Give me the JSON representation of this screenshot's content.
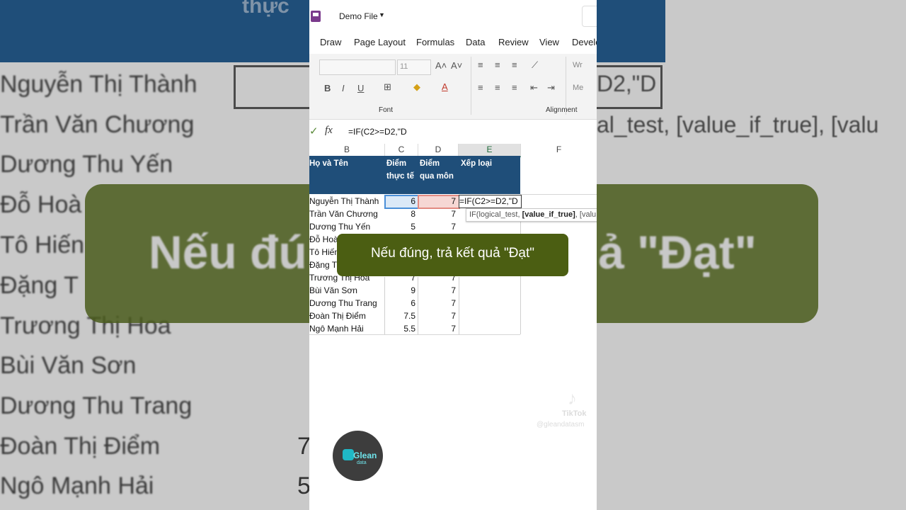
{
  "app": {
    "title": "Demo File",
    "tabs": [
      "Draw",
      "Page Layout",
      "Formulas",
      "Data",
      "Review",
      "View",
      "Develo"
    ]
  },
  "ribbon": {
    "font_size": "11",
    "font_group_label": "Font",
    "alignment_group_label": "Alignment",
    "wrap_label": "Wr",
    "merge_label": "Me"
  },
  "formula_bar": {
    "fx": "fx",
    "content": "=IF(C2>=D2,\"D"
  },
  "columns": [
    "B",
    "C",
    "D",
    "E",
    "F"
  ],
  "header_row": {
    "b": "Họ và Tên",
    "c_line1": "Điểm",
    "c_line2": "thực tế",
    "d_line1": "Điểm",
    "d_line2": "qua môn",
    "e": "Xếp loại"
  },
  "rows": [
    {
      "name": "Nguyễn Thị Thành",
      "actual": "6",
      "pass": "7"
    },
    {
      "name": "Trần Văn Chương",
      "actual": "8",
      "pass": "7"
    },
    {
      "name": "Dương Thu Yến",
      "actual": "5",
      "pass": "7"
    },
    {
      "name": "Đỗ Hoà",
      "actual": "",
      "pass": ""
    },
    {
      "name": "Tô Hiến",
      "actual": "",
      "pass": ""
    },
    {
      "name": "Đặng T",
      "actual": "",
      "pass": ""
    },
    {
      "name": "Trương Thị Hoa",
      "actual": "7",
      "pass": "7"
    },
    {
      "name": "Bùi Văn Sơn",
      "actual": "9",
      "pass": "7"
    },
    {
      "name": "Dương Thu Trang",
      "actual": "6",
      "pass": "7"
    },
    {
      "name": "Đoàn Thị Điểm",
      "actual": "7.5",
      "pass": "7"
    },
    {
      "name": "Ngô Mạnh Hải",
      "actual": "5.5",
      "pass": "7"
    }
  ],
  "edit_cell": "=IF(C2>=D2,\"D",
  "tooltip": {
    "prefix": "IF(logical_test, ",
    "bold": "[value_if_true]",
    "suffix": ", [valu"
  },
  "banner": "Nếu đúng, trả kết quả \"Đạt\"",
  "background": {
    "header_text": "thực",
    "names": [
      "Nguyễn Thị Thành",
      "Trần Văn Chương",
      "Dương Thu Yến",
      "Đỗ Hoà",
      "Tô Hiến",
      "Đặng T",
      "Trương Thị Hoa",
      "Bùi Văn Sơn",
      "Dương Thu Trang",
      "Đoàn Thị Điểm",
      "Ngô Mạnh Hải"
    ],
    "formula": "D2,\"D",
    "tooltip": "al_test, [value_if_true], [valu",
    "banner_left": "Nếu đú",
    "banner_right": "ả \"Đạt\"",
    "num_9": "7",
    "num_10": "5"
  },
  "watermark": {
    "name": "TikTok",
    "handle": "@gleandatasm"
  },
  "logo": {
    "name": "Glean",
    "sub": "data"
  },
  "colors": {
    "header_blue": "#1f4e79",
    "banner_green": "#4b5e12",
    "excel_green": "#217346"
  }
}
